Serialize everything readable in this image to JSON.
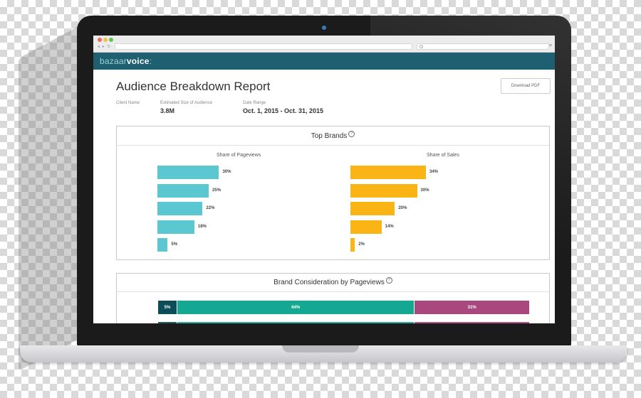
{
  "browser": {
    "nav": "◂ ▸ ↻",
    "menu": "≡"
  },
  "app": {
    "logo_main": "bazaar",
    "logo_accent": "voice",
    "logo_suffix": ":"
  },
  "report": {
    "title": "Audience Breakdown Report",
    "download_label": "Download PDF",
    "client_label": "Client Name",
    "client_value": "",
    "audience_label": "Estimated Size of Audience",
    "audience_value": "3.8M",
    "date_label": "Date Range",
    "date_value": "Oct. 1, 2015 - Oct. 31, 2015"
  },
  "top_brands": {
    "title": "Top Brands",
    "help": "?",
    "pageviews_title": "Share of Pageviews",
    "sales_title": "Share of Sales",
    "pageviews_color": "#5bc7d1",
    "sales_color": "#fbb415"
  },
  "consideration": {
    "title": "Brand Consideration by Pageviews",
    "help": "?",
    "colors": [
      "#0d4d57",
      "#14a892",
      "#a8487e"
    ]
  },
  "chart_data": [
    {
      "type": "bar",
      "orientation": "horizontal",
      "title": "Share of Pageviews",
      "values": [
        30,
        25,
        22,
        18,
        5
      ],
      "labels": [
        "30%",
        "25%",
        "22%",
        "18%",
        "5%"
      ],
      "xlim": [
        0,
        34
      ]
    },
    {
      "type": "bar",
      "orientation": "horizontal",
      "title": "Share of Sales",
      "values": [
        34,
        30,
        20,
        14,
        2
      ],
      "labels": [
        "34%",
        "30%",
        "20%",
        "14%",
        "2%"
      ],
      "xlim": [
        0,
        34
      ]
    },
    {
      "type": "bar",
      "orientation": "horizontal",
      "stacked": true,
      "title": "Brand Consideration by Pageviews",
      "values": [
        5,
        64,
        31
      ],
      "labels": [
        "5%",
        "64%",
        "31%"
      ]
    }
  ]
}
